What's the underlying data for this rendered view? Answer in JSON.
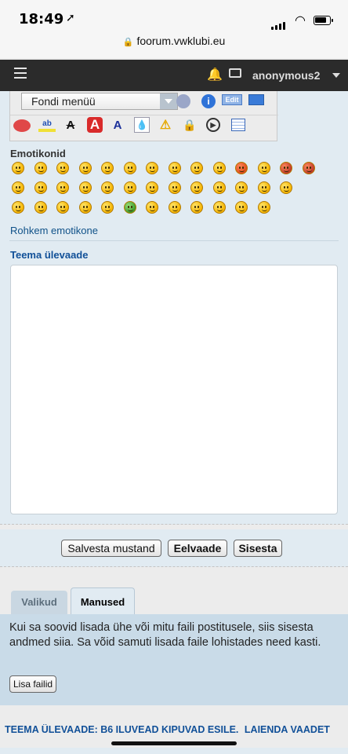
{
  "status_bar": {
    "time": "18:49",
    "battery_level": 0.8
  },
  "browser": {
    "url": "foorum.vwklubi.eu"
  },
  "nav": {
    "username": "anonymous2"
  },
  "editor": {
    "font_select_label": "Fondi menüü",
    "edit_tool_label": "Edit",
    "emoticons_heading": "Emotikonid",
    "more_emoticons_link": "Rohkem emotikone",
    "topic_preview_heading": "Teema ülevaade"
  },
  "actions": {
    "save_draft": "Salvesta mustand",
    "preview": "Eelvaade",
    "submit": "Sisesta"
  },
  "tabs": {
    "options": "Valikud",
    "attachments": "Manused"
  },
  "attachments": {
    "help_text": "Kui sa soovid lisada ühe või mitu faili postitusele, siis sisesta andmed siia. Sa võid samuti lisada faile lohistades need kasti.",
    "add_files_button": "Lisa failid"
  },
  "footer": {
    "topic_review": "TEEMA ÜLEVAADE: B6 ILUVEAD KIPUVAD ESILE.",
    "expand_view": "LAIENDA VAADET"
  }
}
